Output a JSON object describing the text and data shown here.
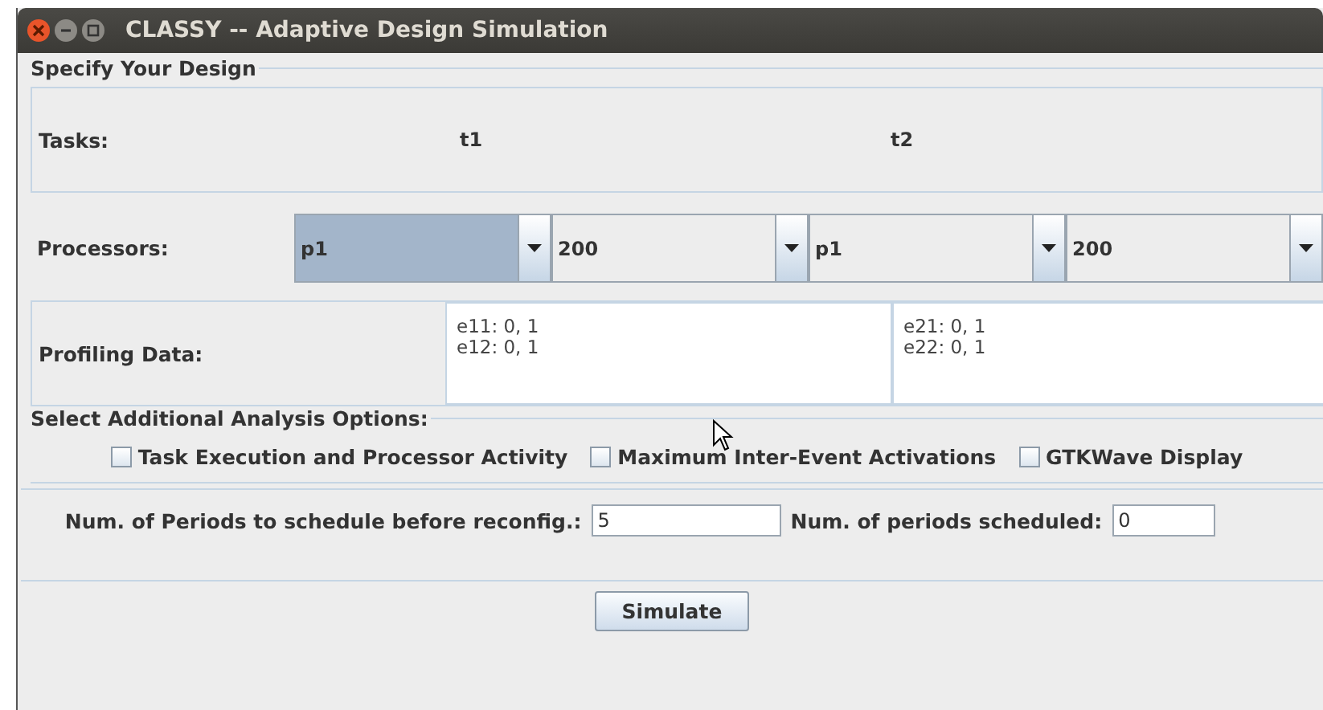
{
  "window": {
    "title": "CLASSY -- Adaptive Design Simulation"
  },
  "design": {
    "legend": "Specify Your Design",
    "tasks": {
      "label": "Tasks:",
      "items": [
        "t1",
        "t2"
      ]
    },
    "processors": {
      "label": "Processors:",
      "combos": [
        {
          "value": "p1",
          "focused": true
        },
        {
          "value": "200",
          "focused": false
        },
        {
          "value": "p1",
          "focused": false
        },
        {
          "value": "200",
          "focused": false
        }
      ]
    },
    "profiling": {
      "label": "Profiling Data:",
      "areas": [
        {
          "lines": [
            "e11: 0, 1",
            "e12: 0, 1"
          ]
        },
        {
          "lines": [
            "e21: 0, 1",
            "e22: 0, 1"
          ]
        }
      ]
    }
  },
  "options": {
    "legend": "Select Additional Analysis Options:",
    "checkboxes": [
      {
        "label": "Task Execution and Processor Activity",
        "checked": false
      },
      {
        "label": "Maximum Inter-Event Activations",
        "checked": false
      },
      {
        "label": "GTKWave Display",
        "checked": false
      }
    ]
  },
  "periods": {
    "fields": [
      {
        "label": "Num. of Periods to schedule before reconfig.:",
        "value": "5"
      },
      {
        "label": "Num. of periods scheduled:",
        "value": "0"
      }
    ]
  },
  "buttons": [
    "Simulate"
  ]
}
